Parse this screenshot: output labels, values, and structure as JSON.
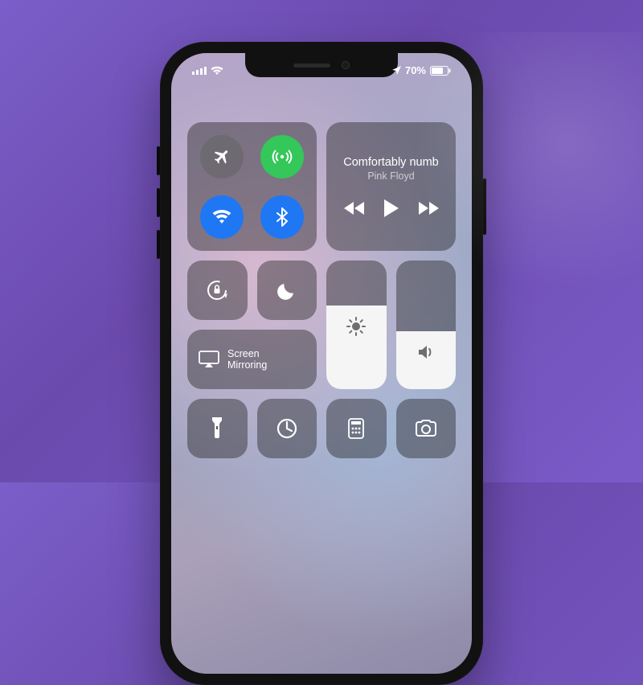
{
  "status": {
    "battery_text": "70%",
    "location_on": true
  },
  "music": {
    "track": "Comfortably numb",
    "artist": "Pink Floyd"
  },
  "mirroring": {
    "label": "Screen\nMirroring"
  },
  "brightness": {
    "level_percent": 65
  },
  "volume": {
    "level_percent": 45
  },
  "connectivity": {
    "airplane_on": false,
    "cellular_on": true,
    "wifi_on": true,
    "bluetooth_on": true
  },
  "icons": {
    "airplane": "airplane-icon",
    "cellular": "cellular-icon",
    "wifi": "wifi-icon",
    "bluetooth": "bluetooth-icon",
    "lock_rotation": "lock-rotation-icon",
    "dnd": "moon-icon",
    "brightness": "sun-icon",
    "volume": "speaker-icon",
    "mirror": "airplay-icon",
    "flashlight": "flashlight-icon",
    "timer": "timer-icon",
    "calculator": "calculator-icon",
    "camera": "camera-icon",
    "prev": "rewind-icon",
    "play": "play-icon",
    "next": "forward-icon"
  }
}
